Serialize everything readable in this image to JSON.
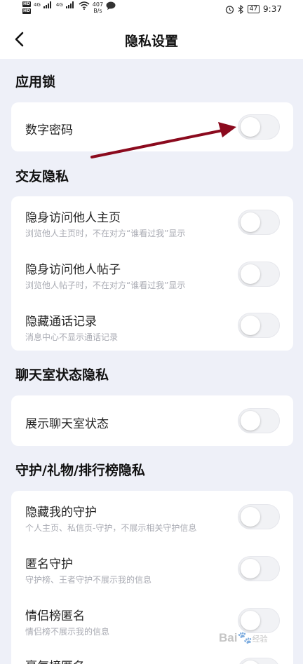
{
  "status_bar": {
    "net_speed_value": "407",
    "net_speed_unit": "B/s",
    "battery": "47",
    "time": "9:37",
    "network_left": "4G",
    "network_right": "4G"
  },
  "header": {
    "title": "隐私设置"
  },
  "sections": [
    {
      "title": "应用锁",
      "items": [
        {
          "label": "数字密码",
          "sub": "",
          "on": false
        }
      ]
    },
    {
      "title": "交友隐私",
      "items": [
        {
          "label": "隐身访问他人主页",
          "sub": "浏览他人主页时，不在对方“谁看过我”显示",
          "on": false
        },
        {
          "label": "隐身访问他人帖子",
          "sub": "浏览他人帖子时，不在对方“谁看过我”显示",
          "on": false
        },
        {
          "label": "隐藏通话记录",
          "sub": "消息中心不显示通话记录",
          "on": false
        }
      ]
    },
    {
      "title": "聊天室状态隐私",
      "items": [
        {
          "label": "展示聊天室状态",
          "sub": "",
          "on": false
        }
      ]
    },
    {
      "title": "守护/礼物/排行榜隐私",
      "items": [
        {
          "label": "隐藏我的守护",
          "sub": "个人主页、私信页-守护，不展示相关守护信息",
          "on": false
        },
        {
          "label": "匿名守护",
          "sub": "守护榜、王者守护不展示我的信息",
          "on": false
        },
        {
          "label": "情侣榜匿名",
          "sub": "情侣榜不展示我的信息",
          "on": false
        },
        {
          "label": "豪气榜匿名",
          "sub": "",
          "on": false
        }
      ]
    }
  ],
  "watermark": {
    "brand": "Bai",
    "suffix": "经验"
  },
  "colors": {
    "annotation_arrow": "#8b0a1e",
    "page_bg": "#eef0f8",
    "toggle_off": "#f1f2f5"
  }
}
